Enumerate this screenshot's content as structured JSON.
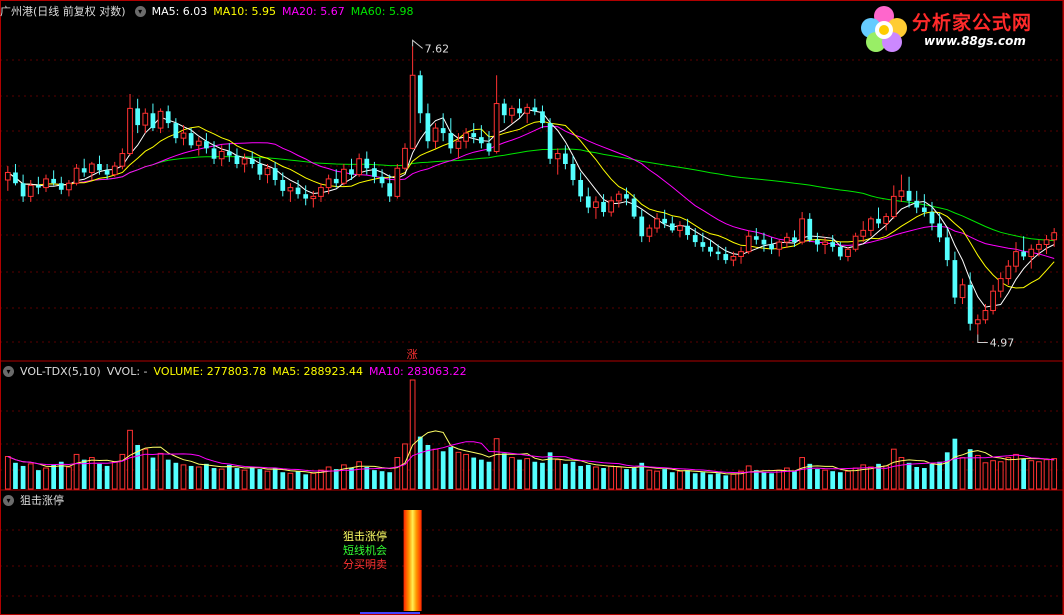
{
  "price_panel": {
    "title": "广州港(日线 前复权 对数)",
    "ma5_label": "MA5: 6.03",
    "ma10_label": "MA10: 5.95",
    "ma20_label": "MA20: 5.67",
    "ma60_label": "MA60: 5.98",
    "high_label": "7.62",
    "low_label": "4.97",
    "limit_up_mark": "涨"
  },
  "volume_panel": {
    "title": "VOL-TDX(5,10)",
    "vvol_label": "VVOL: -",
    "volume_label": "VOLUME: 277803.78",
    "ma5_label": "MA5: 288923.44",
    "ma10_label": "MA10: 283063.22"
  },
  "signal_panel": {
    "title": "狙击涨停",
    "signal_line1": "狙击涨停",
    "signal_line2": "短线机会",
    "signal_line3": "分买明卖"
  },
  "watermark": {
    "brand": "分析家公式网",
    "url": "www.88gs.com"
  },
  "colors": {
    "up": "#ff3232",
    "down": "#54ffff",
    "ma5": "#ffffff",
    "ma10": "#ffff00",
    "ma20": "#ff00ff",
    "ma60": "#00e600",
    "panel_border": "#b00000"
  },
  "chart_data": {
    "type": "candlestick",
    "scale": "log",
    "ylim": [
      4.97,
      7.62
    ],
    "annotations": [
      "7.62",
      "4.97"
    ],
    "candles_ohlc": [
      [
        6.25,
        6.38,
        6.15,
        6.32
      ],
      [
        6.32,
        6.4,
        6.2,
        6.22
      ],
      [
        6.22,
        6.3,
        6.05,
        6.1
      ],
      [
        6.1,
        6.25,
        6.05,
        6.2
      ],
      [
        6.2,
        6.28,
        6.12,
        6.18
      ],
      [
        6.18,
        6.3,
        6.14,
        6.26
      ],
      [
        6.26,
        6.34,
        6.2,
        6.22
      ],
      [
        6.22,
        6.28,
        6.12,
        6.16
      ],
      [
        6.16,
        6.25,
        6.1,
        6.22
      ],
      [
        6.22,
        6.4,
        6.2,
        6.36
      ],
      [
        6.36,
        6.45,
        6.28,
        6.32
      ],
      [
        6.32,
        6.42,
        6.25,
        6.4
      ],
      [
        6.4,
        6.48,
        6.3,
        6.34
      ],
      [
        6.34,
        6.4,
        6.26,
        6.3
      ],
      [
        6.3,
        6.42,
        6.28,
        6.38
      ],
      [
        6.38,
        6.55,
        6.35,
        6.5
      ],
      [
        6.5,
        7.1,
        6.48,
        6.95
      ],
      [
        6.95,
        7.05,
        6.7,
        6.78
      ],
      [
        6.78,
        6.95,
        6.7,
        6.9
      ],
      [
        6.9,
        7.0,
        6.72,
        6.75
      ],
      [
        6.75,
        6.95,
        6.7,
        6.92
      ],
      [
        6.92,
        6.98,
        6.75,
        6.8
      ],
      [
        6.8,
        6.85,
        6.6,
        6.65
      ],
      [
        6.65,
        6.78,
        6.58,
        6.7
      ],
      [
        6.7,
        6.75,
        6.55,
        6.58
      ],
      [
        6.58,
        6.66,
        6.48,
        6.62
      ],
      [
        6.62,
        6.7,
        6.5,
        6.55
      ],
      [
        6.55,
        6.62,
        6.4,
        6.45
      ],
      [
        6.45,
        6.58,
        6.38,
        6.52
      ],
      [
        6.52,
        6.6,
        6.42,
        6.48
      ],
      [
        6.48,
        6.55,
        6.36,
        6.4
      ],
      [
        6.4,
        6.5,
        6.32,
        6.45
      ],
      [
        6.45,
        6.52,
        6.36,
        6.4
      ],
      [
        6.4,
        6.46,
        6.25,
        6.3
      ],
      [
        6.3,
        6.4,
        6.22,
        6.36
      ],
      [
        6.36,
        6.42,
        6.2,
        6.25
      ],
      [
        6.25,
        6.32,
        6.1,
        6.15
      ],
      [
        6.15,
        6.22,
        6.05,
        6.18
      ],
      [
        6.18,
        6.25,
        6.08,
        6.12
      ],
      [
        6.12,
        6.2,
        6.02,
        6.08
      ],
      [
        6.08,
        6.15,
        6.0,
        6.1
      ],
      [
        6.1,
        6.22,
        6.05,
        6.18
      ],
      [
        6.18,
        6.3,
        6.12,
        6.26
      ],
      [
        6.26,
        6.35,
        6.18,
        6.22
      ],
      [
        6.22,
        6.4,
        6.2,
        6.35
      ],
      [
        6.35,
        6.45,
        6.25,
        6.3
      ],
      [
        6.3,
        6.5,
        6.28,
        6.45
      ],
      [
        6.45,
        6.52,
        6.3,
        6.36
      ],
      [
        6.36,
        6.42,
        6.22,
        6.28
      ],
      [
        6.28,
        6.35,
        6.18,
        6.22
      ],
      [
        6.22,
        6.3,
        6.05,
        6.1
      ],
      [
        6.1,
        6.4,
        6.08,
        6.36
      ],
      [
        6.36,
        6.6,
        6.34,
        6.55
      ],
      [
        6.55,
        7.62,
        6.54,
        7.3
      ],
      [
        7.3,
        7.35,
        6.8,
        6.9
      ],
      [
        6.9,
        7.0,
        6.55,
        6.62
      ],
      [
        6.62,
        6.8,
        6.55,
        6.75
      ],
      [
        6.75,
        6.9,
        6.62,
        6.7
      ],
      [
        6.7,
        6.85,
        6.5,
        6.55
      ],
      [
        6.55,
        6.7,
        6.45,
        6.62
      ],
      [
        6.62,
        6.75,
        6.55,
        6.7
      ],
      [
        6.7,
        6.8,
        6.6,
        6.66
      ],
      [
        6.66,
        6.78,
        6.55,
        6.6
      ],
      [
        6.6,
        6.72,
        6.48,
        6.52
      ],
      [
        6.52,
        7.3,
        6.5,
        7.0
      ],
      [
        7.0,
        7.05,
        6.8,
        6.88
      ],
      [
        6.88,
        6.98,
        6.8,
        6.95
      ],
      [
        6.95,
        7.05,
        6.85,
        6.9
      ],
      [
        6.9,
        7.0,
        6.8,
        6.96
      ],
      [
        6.96,
        7.05,
        6.88,
        6.92
      ],
      [
        6.92,
        6.98,
        6.75,
        6.8
      ],
      [
        6.8,
        6.85,
        6.4,
        6.45
      ],
      [
        6.45,
        6.55,
        6.3,
        6.5
      ],
      [
        6.5,
        6.58,
        6.35,
        6.4
      ],
      [
        6.4,
        6.48,
        6.2,
        6.25
      ],
      [
        6.25,
        6.32,
        6.05,
        6.1
      ],
      [
        6.1,
        6.18,
        5.95,
        6.0
      ],
      [
        6.0,
        6.1,
        5.9,
        6.05
      ],
      [
        6.05,
        6.12,
        5.92,
        5.96
      ],
      [
        5.96,
        6.1,
        5.92,
        6.06
      ],
      [
        6.06,
        6.15,
        6.0,
        6.12
      ],
      [
        6.12,
        6.18,
        6.02,
        6.08
      ],
      [
        6.08,
        6.12,
        5.9,
        5.92
      ],
      [
        5.92,
        5.98,
        5.7,
        5.75
      ],
      [
        5.75,
        5.85,
        5.7,
        5.82
      ],
      [
        5.82,
        5.95,
        5.78,
        5.9
      ],
      [
        5.9,
        5.98,
        5.82,
        5.86
      ],
      [
        5.86,
        5.92,
        5.78,
        5.8
      ],
      [
        5.8,
        5.88,
        5.74,
        5.84
      ],
      [
        5.84,
        5.9,
        5.72,
        5.76
      ],
      [
        5.76,
        5.82,
        5.66,
        5.7
      ],
      [
        5.7,
        5.78,
        5.62,
        5.66
      ],
      [
        5.66,
        5.72,
        5.58,
        5.62
      ],
      [
        5.62,
        5.68,
        5.55,
        5.6
      ],
      [
        5.6,
        5.66,
        5.52,
        5.55
      ],
      [
        5.55,
        5.62,
        5.5,
        5.58
      ],
      [
        5.58,
        5.66,
        5.52,
        5.62
      ],
      [
        5.62,
        5.8,
        5.6,
        5.75
      ],
      [
        5.75,
        5.82,
        5.68,
        5.72
      ],
      [
        5.72,
        5.78,
        5.62,
        5.68
      ],
      [
        5.68,
        5.74,
        5.6,
        5.64
      ],
      [
        5.64,
        5.72,
        5.58,
        5.7
      ],
      [
        5.7,
        5.78,
        5.65,
        5.74
      ],
      [
        5.74,
        5.8,
        5.66,
        5.7
      ],
      [
        5.7,
        5.96,
        5.68,
        5.9
      ],
      [
        5.9,
        5.95,
        5.7,
        5.72
      ],
      [
        5.72,
        5.78,
        5.62,
        5.68
      ],
      [
        5.68,
        5.74,
        5.6,
        5.7
      ],
      [
        5.7,
        5.76,
        5.62,
        5.66
      ],
      [
        5.66,
        5.7,
        5.55,
        5.58
      ],
      [
        5.58,
        5.66,
        5.54,
        5.64
      ],
      [
        5.64,
        5.78,
        5.62,
        5.75
      ],
      [
        5.75,
        5.88,
        5.7,
        5.8
      ],
      [
        5.8,
        5.92,
        5.75,
        5.9
      ],
      [
        5.9,
        6.0,
        5.82,
        5.86
      ],
      [
        5.86,
        5.95,
        5.8,
        5.92
      ],
      [
        5.92,
        6.2,
        5.9,
        6.1
      ],
      [
        6.1,
        6.3,
        6.05,
        6.15
      ],
      [
        6.15,
        6.28,
        6.0,
        6.06
      ],
      [
        6.06,
        6.15,
        5.95,
        6.0
      ],
      [
        6.0,
        6.12,
        5.92,
        5.96
      ],
      [
        5.96,
        6.05,
        5.8,
        5.86
      ],
      [
        5.86,
        5.95,
        5.7,
        5.74
      ],
      [
        5.74,
        5.82,
        5.5,
        5.55
      ],
      [
        5.55,
        5.62,
        5.2,
        5.25
      ],
      [
        5.25,
        5.4,
        5.2,
        5.35
      ],
      [
        5.35,
        5.45,
        5.0,
        5.05
      ],
      [
        5.05,
        5.12,
        4.97,
        5.08
      ],
      [
        5.08,
        5.2,
        5.05,
        5.15
      ],
      [
        5.15,
        5.35,
        5.12,
        5.3
      ],
      [
        5.3,
        5.45,
        5.25,
        5.4
      ],
      [
        5.4,
        5.55,
        5.35,
        5.5
      ],
      [
        5.5,
        5.7,
        5.45,
        5.62
      ],
      [
        5.62,
        5.75,
        5.55,
        5.58
      ],
      [
        5.58,
        5.68,
        5.48,
        5.64
      ],
      [
        5.64,
        5.72,
        5.58,
        5.68
      ],
      [
        5.68,
        5.76,
        5.6,
        5.72
      ],
      [
        5.72,
        5.82,
        5.66,
        5.78
      ]
    ],
    "volumes": [
      310000,
      250000,
      220000,
      240000,
      180000,
      200000,
      230000,
      260000,
      210000,
      330000,
      280000,
      300000,
      240000,
      220000,
      260000,
      330000,
      560000,
      420000,
      380000,
      300000,
      340000,
      280000,
      250000,
      230000,
      220000,
      210000,
      240000,
      200000,
      190000,
      230000,
      200000,
      180000,
      210000,
      190000,
      170000,
      200000,
      160000,
      150000,
      170000,
      140000,
      150000,
      180000,
      210000,
      190000,
      230000,
      200000,
      260000,
      210000,
      180000,
      170000,
      160000,
      300000,
      430000,
      1040000,
      500000,
      420000,
      380000,
      360000,
      400000,
      350000,
      330000,
      300000,
      280000,
      260000,
      480000,
      340000,
      300000,
      280000,
      290000,
      260000,
      250000,
      350000,
      280000,
      240000,
      260000,
      220000,
      230000,
      210000,
      200000,
      220000,
      210000,
      190000,
      200000,
      250000,
      180000,
      170000,
      190000,
      160000,
      170000,
      180000,
      150000,
      160000,
      140000,
      150000,
      130000,
      140000,
      170000,
      220000,
      180000,
      160000,
      150000,
      180000,
      200000,
      170000,
      300000,
      240000,
      190000,
      180000,
      170000,
      160000,
      170000,
      200000,
      230000,
      210000,
      240000,
      220000,
      380000,
      300000,
      250000,
      210000,
      200000,
      240000,
      260000,
      350000,
      480000,
      300000,
      380000,
      320000,
      250000,
      270000,
      260000,
      300000,
      330000,
      290000,
      270000,
      260000,
      280000,
      290000
    ],
    "series": [
      {
        "name": "MA5",
        "last": 6.03
      },
      {
        "name": "MA10",
        "last": 5.95
      },
      {
        "name": "MA20",
        "last": 5.67
      },
      {
        "name": "MA60",
        "last": 5.98
      }
    ],
    "volume_series": [
      {
        "name": "VOLUME",
        "last": 277803.78
      },
      {
        "name": "MA5",
        "last": 288923.44
      },
      {
        "name": "MA10",
        "last": 283063.22
      }
    ],
    "signal_index": 53
  }
}
